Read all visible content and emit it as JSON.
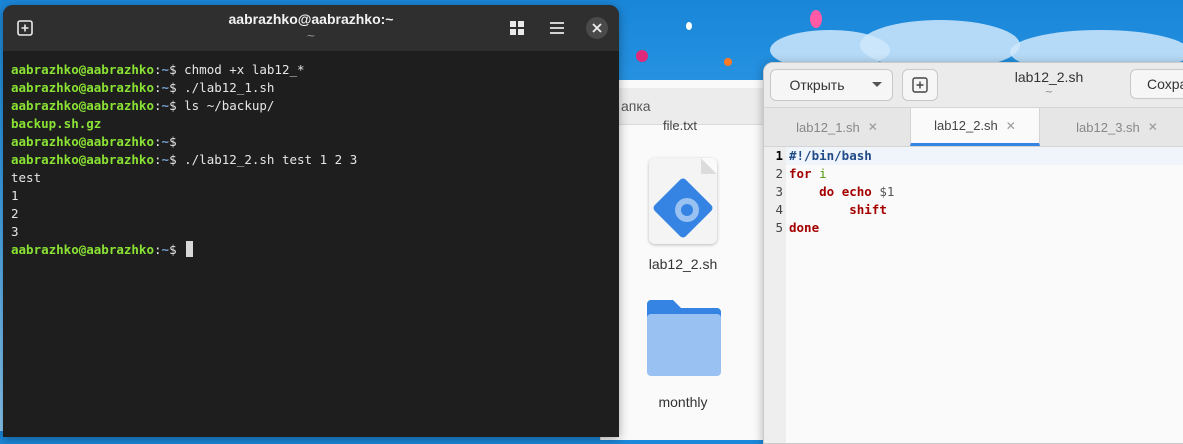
{
  "terminal": {
    "title": "aabrazhko@aabrazhko:~",
    "subtitle": "~",
    "lines": [
      {
        "type": "prompt",
        "user": "aabrazhko@aabrazhko",
        "path": "~",
        "cmd": "chmod +x lab12_*"
      },
      {
        "type": "prompt",
        "user": "aabrazhko@aabrazhko",
        "path": "~",
        "cmd": "./lab12_1.sh"
      },
      {
        "type": "prompt",
        "user": "aabrazhko@aabrazhko",
        "path": "~",
        "cmd": "ls ~/backup/"
      },
      {
        "type": "file",
        "text": "backup.sh.gz"
      },
      {
        "type": "prompt",
        "user": "aabrazhko@aabrazhko",
        "path": "~",
        "cmd": ""
      },
      {
        "type": "prompt",
        "user": "aabrazhko@aabrazhko",
        "path": "~",
        "cmd": "./lab12_2.sh test 1 2 3"
      },
      {
        "type": "out",
        "text": "test"
      },
      {
        "type": "out",
        "text": "1"
      },
      {
        "type": "out",
        "text": "2"
      },
      {
        "type": "out",
        "text": "3"
      },
      {
        "type": "prompt",
        "user": "aabrazhko@aabrazhko",
        "path": "~",
        "cmd": "",
        "cursor": true
      }
    ]
  },
  "files": {
    "header_partial": "апка",
    "partial_label": "file.txt",
    "items": [
      {
        "label": "lab12_2.sh",
        "icon": "script-icon"
      },
      {
        "label": "monthly",
        "icon": "folder-icon"
      }
    ]
  },
  "editor": {
    "open_label": "Открыть",
    "title": "lab12_2.sh",
    "subtitle": "~",
    "save_label": "Сохра",
    "tabs": [
      {
        "label": "lab12_1.sh",
        "active": false
      },
      {
        "label": "lab12_2.sh",
        "active": true
      },
      {
        "label": "lab12_3.sh",
        "active": false
      }
    ],
    "line_numbers": [
      "1",
      "2",
      "3",
      "4",
      "5"
    ],
    "code": [
      [
        {
          "t": "#!/bin/bash",
          "c": "shebang"
        }
      ],
      [
        {
          "t": "for",
          "c": "kw"
        },
        {
          "t": " ",
          "c": ""
        },
        {
          "t": "i",
          "c": "var"
        }
      ],
      [
        {
          "t": "    ",
          "c": ""
        },
        {
          "t": "do",
          "c": "kw"
        },
        {
          "t": " ",
          "c": ""
        },
        {
          "t": "echo",
          "c": "kw"
        },
        {
          "t": " ",
          "c": ""
        },
        {
          "t": "$1",
          "c": "varref"
        }
      ],
      [
        {
          "t": "        ",
          "c": ""
        },
        {
          "t": "shift",
          "c": "kw"
        }
      ],
      [
        {
          "t": "done",
          "c": "kw"
        }
      ]
    ]
  }
}
